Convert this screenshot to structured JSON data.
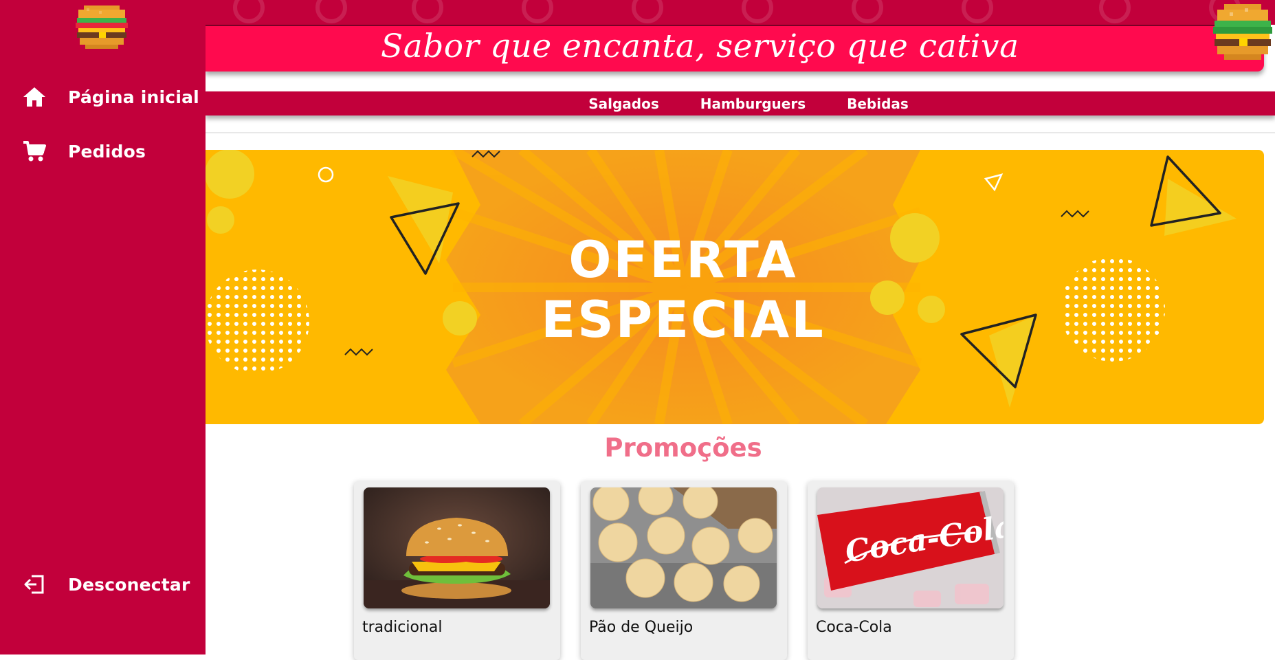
{
  "sidebar": {
    "logo": "burger-logo-icon",
    "items": [
      {
        "label": "Página inicial",
        "icon": "home-icon"
      },
      {
        "label": "Pedidos",
        "icon": "cart-icon"
      }
    ],
    "logout": {
      "label": "Desconectar",
      "icon": "logout-icon"
    }
  },
  "header": {
    "slogan": "Sabor que encanta, serviço que cativa",
    "mascot": "pixel-burger-icon"
  },
  "nav": {
    "links": [
      "Salgados",
      "Hamburguers",
      "Bebidas"
    ]
  },
  "banner": {
    "line1": "OFERTA",
    "line2": "ESPECIAL"
  },
  "promotions": {
    "title": "Promoções",
    "items": [
      {
        "name": "tradicional"
      },
      {
        "name": "Pão de Queijo"
      },
      {
        "name": "Coca-Cola"
      }
    ]
  },
  "colors": {
    "primary": "#c2003b",
    "header_band": "#ff0a4e",
    "banner": "#ffb900",
    "promo_title": "#f06e89"
  }
}
